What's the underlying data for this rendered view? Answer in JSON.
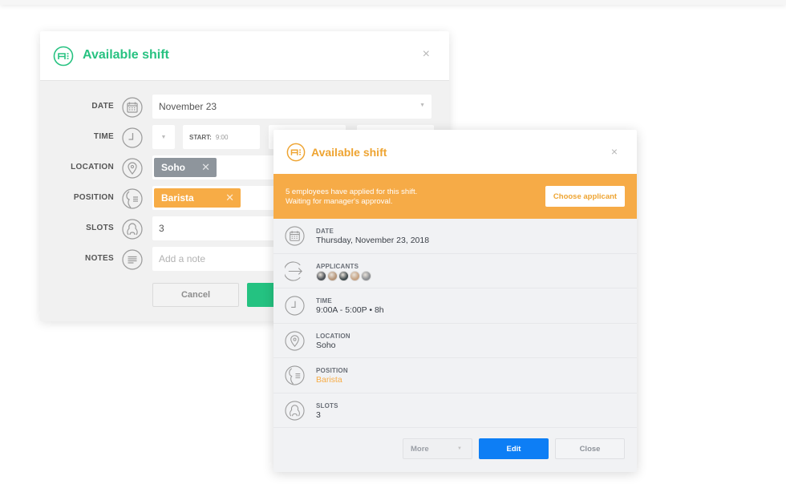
{
  "colors": {
    "green": "#27c281",
    "orange": "#f6ab47",
    "blue": "#0d7ef5",
    "grey_chip": "#8e959c",
    "icon_grey": "#9a9a9a"
  },
  "back_modal": {
    "title": "Available shift",
    "logo_icon": "shift-logo-icon",
    "close_icon": "×",
    "fields": {
      "date": {
        "label": "DATE",
        "icon": "calendar-icon",
        "value": "November 23"
      },
      "time": {
        "label": "TIME",
        "icon": "clock-icon",
        "start_label": "START:",
        "start_value": "9:00"
      },
      "location": {
        "label": "LOCATION",
        "icon": "location-pin-icon",
        "chip": "Soho"
      },
      "position": {
        "label": "POSITION",
        "icon": "position-icon",
        "chip": "Barista"
      },
      "slots": {
        "label": "SLOTS",
        "icon": "people-icon",
        "value": "3"
      },
      "notes": {
        "label": "NOTES",
        "icon": "notes-icon",
        "placeholder": "Add a note"
      }
    },
    "buttons": {
      "cancel": "Cancel",
      "save": ""
    }
  },
  "front_modal": {
    "title": "Available shift",
    "close_icon": "×",
    "banner": {
      "line1": "5 employees have applied for this shift.",
      "line2": "Waiting for manager's approval.",
      "button": "Choose applicant"
    },
    "rows": [
      {
        "label": "DATE",
        "icon": "calendar-icon",
        "value": "Thursday, November 23, 2018"
      },
      {
        "label": "APPLICANTS",
        "icon": "arrow-in-icon",
        "avatars": [
          "#4d5258",
          "#b49478",
          "#3f4a4d",
          "#c6a383",
          "#8c8f93"
        ]
      },
      {
        "label": "TIME",
        "icon": "clock-icon",
        "value": "9:00A - 5:00P • 8h"
      },
      {
        "label": "LOCATION",
        "icon": "location-pin-icon",
        "value": "Soho"
      },
      {
        "label": "POSITION",
        "icon": "position-icon",
        "value": "Barista"
      },
      {
        "label": "SLOTS",
        "icon": "people-icon",
        "value": "3"
      }
    ],
    "footer": {
      "more": "More",
      "edit": "Edit",
      "close": "Close"
    }
  }
}
